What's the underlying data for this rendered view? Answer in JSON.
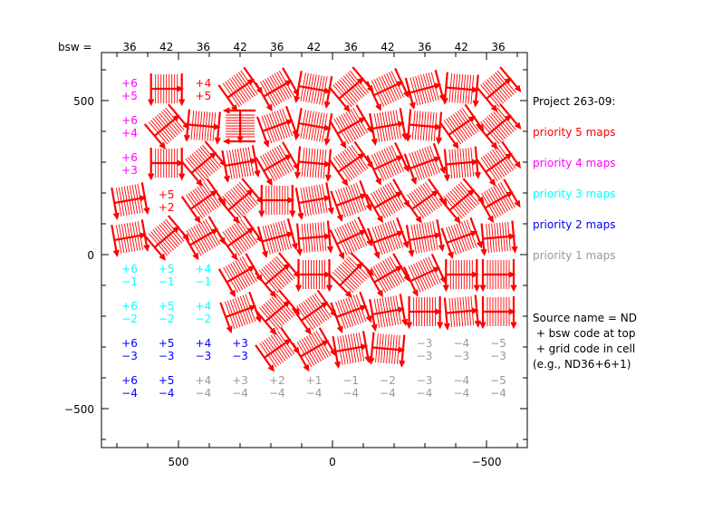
{
  "colors": {
    "p5": "#ff0000",
    "p4": "#ff00ff",
    "p3": "#00ffff",
    "p2": "#0000ff",
    "p1": "#999999",
    "map": "#ff0000",
    "axis": "#000000"
  },
  "top": {
    "label": "bsw =",
    "values": [
      "36",
      "42",
      "36",
      "42",
      "36",
      "42",
      "36",
      "42",
      "36",
      "42",
      "36"
    ]
  },
  "axes": {
    "y_ticks": [
      {
        "v": 500,
        "label": "500"
      },
      {
        "v": 0,
        "label": "0"
      },
      {
        "v": -500,
        "label": "−500"
      }
    ],
    "x_ticks": [
      {
        "v": 500,
        "label": "500"
      },
      {
        "v": 0,
        "label": "0"
      },
      {
        "v": -500,
        "label": "−500"
      }
    ],
    "x_reversed": true
  },
  "legend": {
    "title": "Project 263-09:",
    "items": [
      {
        "label": "priority 5 maps",
        "color": "#ff0000"
      },
      {
        "label": "priority 4 maps",
        "color": "#ff00ff"
      },
      {
        "label": "priority 3 maps",
        "color": "#00ffff"
      },
      {
        "label": "priority 2 maps",
        "color": "#0000ff"
      },
      {
        "label": "priority 1 maps",
        "color": "#999999"
      }
    ],
    "note": [
      "Source name = ND",
      " + bsw code at top",
      " + grid code in cell",
      "(e.g., ND36+6+1)"
    ]
  },
  "grid": [
    [
      {
        "t": "+6",
        "g": "+5",
        "c": "#ff00ff"
      },
      {
        "map": 0
      },
      {
        "t": "+4",
        "g": "+5",
        "c": "#ff0000"
      },
      {
        "map": -35
      },
      {
        "map": -30
      },
      {
        "map": 10
      },
      {
        "map": -40
      },
      {
        "map": -25
      },
      {
        "map": -15
      },
      {
        "map": 5
      },
      {
        "map": -40
      }
    ],
    [
      {
        "t": "+6",
        "g": "+4",
        "c": "#ff00ff"
      },
      {
        "map": -40
      },
      {
        "map": 5
      },
      {
        "map": 90
      },
      {
        "map": -20
      },
      {
        "map": 10
      },
      {
        "map": -30
      },
      {
        "map": -10
      },
      {
        "map": 5
      },
      {
        "map": -35
      },
      {
        "map": -40
      }
    ],
    [
      {
        "t": "+6",
        "g": "+3",
        "c": "#ff00ff"
      },
      {
        "map": 0
      },
      {
        "map": -40
      },
      {
        "map": -10
      },
      {
        "map": -30
      },
      {
        "map": 5
      },
      {
        "map": -35
      },
      {
        "map": -25
      },
      {
        "map": -20
      },
      {
        "map": -5
      },
      {
        "map": -35
      }
    ],
    [
      {
        "map": -10
      },
      {
        "t": "+5",
        "g": "+2",
        "c": "#ff0000"
      },
      {
        "map": -35
      },
      {
        "map": -40
      },
      {
        "map": 0
      },
      {
        "map": -10
      },
      {
        "map": -20
      },
      {
        "map": -30
      },
      {
        "map": -35
      },
      {
        "map": -40
      },
      {
        "map": -30
      }
    ],
    [
      {
        "map": -10
      },
      {
        "map": -40
      },
      {
        "map": -30
      },
      {
        "map": -35
      },
      {
        "map": -15
      },
      {
        "map": -5
      },
      {
        "map": -25
      },
      {
        "map": -20
      },
      {
        "map": -10
      },
      {
        "map": -20
      },
      {
        "map": -5
      }
    ],
    [
      {
        "t": "+6",
        "g": "−1",
        "c": "#00ffff"
      },
      {
        "t": "+5",
        "g": "−1",
        "c": "#00ffff"
      },
      {
        "t": "+4",
        "g": "−1",
        "c": "#00ffff"
      },
      {
        "map": -30
      },
      {
        "map": -40
      },
      {
        "map": 0
      },
      {
        "map": -45
      },
      {
        "map": -30
      },
      {
        "map": -25
      },
      {
        "map": 0
      },
      {
        "map": 0
      }
    ],
    [
      {
        "t": "+6",
        "g": "−2",
        "c": "#00ffff"
      },
      {
        "t": "+5",
        "g": "−2",
        "c": "#00ffff"
      },
      {
        "t": "+4",
        "g": "−2",
        "c": "#00ffff"
      },
      {
        "map": -20
      },
      {
        "map": -40
      },
      {
        "map": -35
      },
      {
        "map": -20
      },
      {
        "map": -10
      },
      {
        "map": 0
      },
      {
        "map": -5
      },
      {
        "map": 0
      }
    ],
    [
      {
        "t": "+6",
        "g": "−3",
        "c": "#0000ff"
      },
      {
        "t": "+5",
        "g": "−3",
        "c": "#0000ff"
      },
      {
        "t": "+4",
        "g": "−3",
        "c": "#0000ff"
      },
      {
        "t": "+3",
        "g": "−3",
        "c": "#0000ff"
      },
      {
        "map": -35
      },
      {
        "map": -30
      },
      {
        "map": -10
      },
      {
        "map": 5
      },
      {
        "t": "−3",
        "g": "−3",
        "c": "#999999"
      },
      {
        "t": "−4",
        "g": "−3",
        "c": "#999999"
      },
      {
        "t": "−5",
        "g": "−3",
        "c": "#999999"
      }
    ],
    [
      {
        "t": "+6",
        "g": "−4",
        "c": "#0000ff"
      },
      {
        "t": "+5",
        "g": "−4",
        "c": "#0000ff"
      },
      {
        "t": "+4",
        "g": "−4",
        "c": "#999999"
      },
      {
        "t": "+3",
        "g": "−4",
        "c": "#999999"
      },
      {
        "t": "+2",
        "g": "−4",
        "c": "#999999"
      },
      {
        "t": "+1",
        "g": "−4",
        "c": "#999999"
      },
      {
        "t": "−1",
        "g": "−4",
        "c": "#999999"
      },
      {
        "t": "−2",
        "g": "−4",
        "c": "#999999"
      },
      {
        "t": "−3",
        "g": "−4",
        "c": "#999999"
      },
      {
        "t": "−4",
        "g": "−4",
        "c": "#999999"
      },
      {
        "t": "−5",
        "g": "−4",
        "c": "#999999"
      }
    ]
  ]
}
